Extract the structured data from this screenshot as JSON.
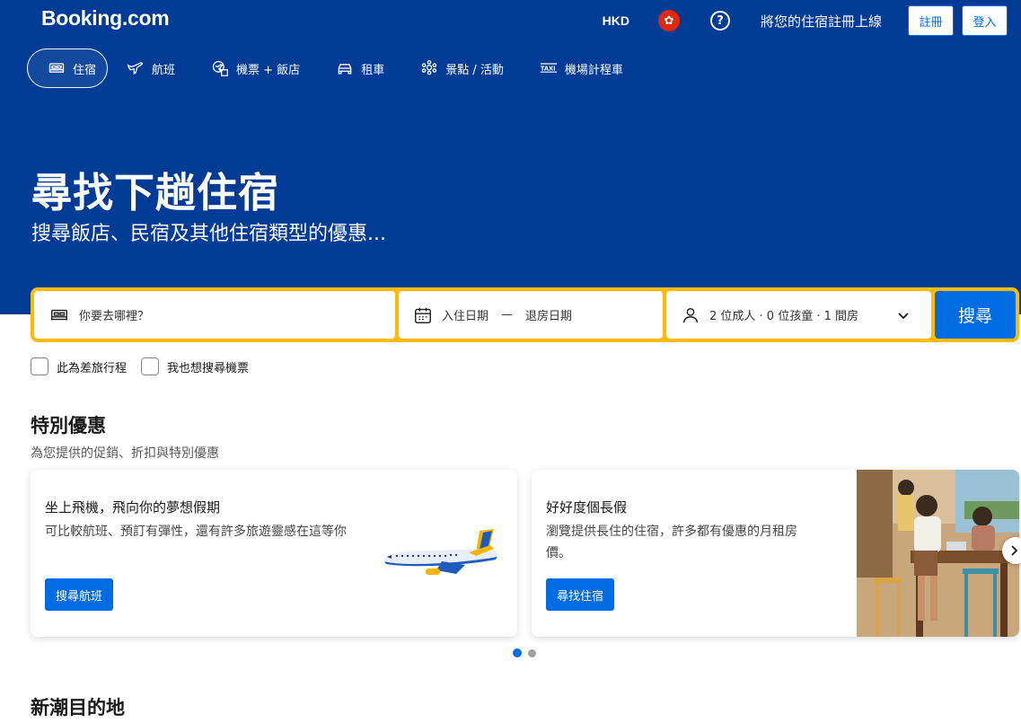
{
  "header": {
    "logo": "Booking.com",
    "currency": "HKD",
    "list_property": "將您的住宿註冊上線",
    "register": "註冊",
    "sign_in": "登入"
  },
  "nav": {
    "items": [
      {
        "label": "住宿",
        "icon": "bed-icon",
        "active": true
      },
      {
        "label": "航班",
        "icon": "plane-icon"
      },
      {
        "label": "機票 + 飯店",
        "icon": "flight-hotel-icon"
      },
      {
        "label": "租車",
        "icon": "car-icon"
      },
      {
        "label": "景點 / 活動",
        "icon": "attractions-icon"
      },
      {
        "label": "機場計程車",
        "icon": "taxi-icon"
      }
    ]
  },
  "hero": {
    "title": "尋找下趟住宿",
    "subtitle": "搜尋飯店、民宿及其他住宿類型的優惠..."
  },
  "search": {
    "destination_placeholder": "你要去哪裡？",
    "checkin": "入住日期",
    "separator": "—",
    "checkout": "退房日期",
    "guests": "2 位成人 · 0 位孩童 · 1 間房",
    "button": "搜尋"
  },
  "options": {
    "business_trip": "此為差旅行程",
    "search_flights": "我也想搜尋機票"
  },
  "offers": {
    "title": "特別優惠",
    "subtitle": "為您提供的促銷、折扣與特別優惠",
    "cards": [
      {
        "title": "坐上飛機，飛向你的夢想假期",
        "text": "可比較航班、預訂有彈性，還有許多旅遊靈感在這等你",
        "button": "搜尋航班"
      },
      {
        "title": "好好度個長假",
        "text": "瀏覽提供長住的住宿，許多都有優惠的月租房價。",
        "button": "尋找住宿"
      }
    ]
  },
  "trending": {
    "title": "新潮目的地"
  },
  "colors": {
    "brand_blue": "#003b95",
    "action_blue": "#006ce4",
    "search_yellow": "#febb02"
  }
}
